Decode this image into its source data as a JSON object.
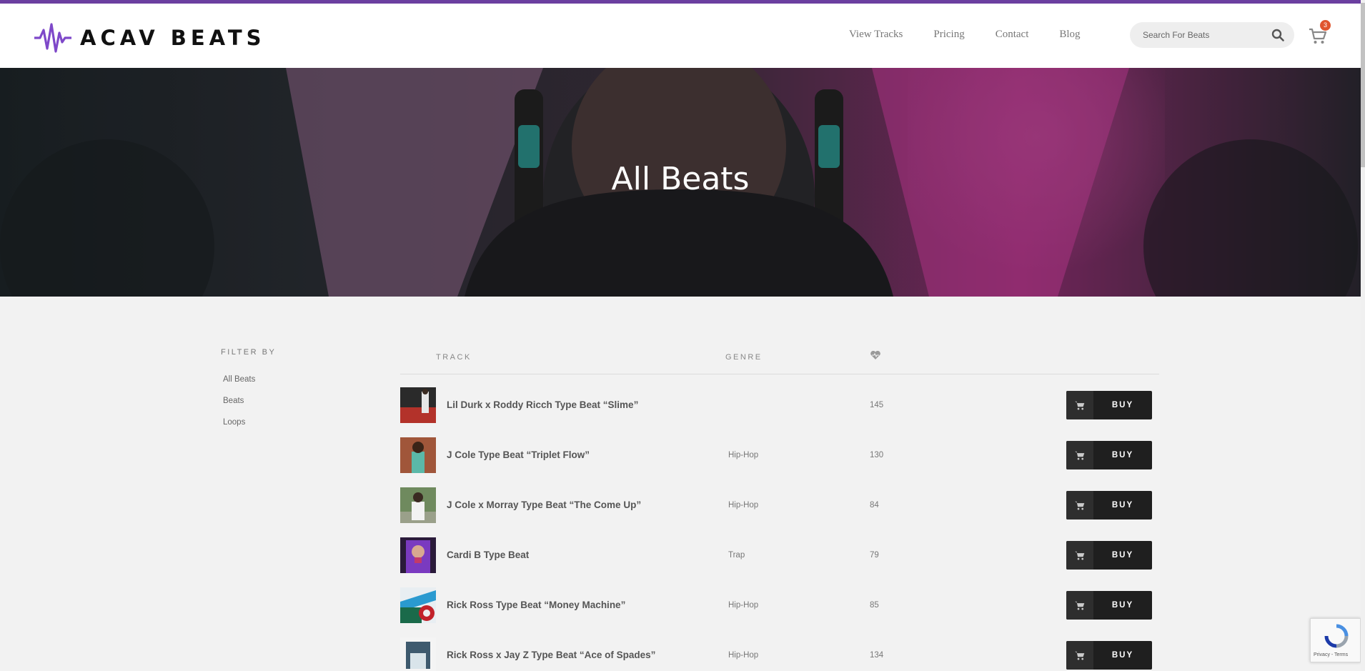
{
  "brand": {
    "name": "ACAV BEATS",
    "accent": "#7e48c9"
  },
  "nav": [
    {
      "label": "View Tracks"
    },
    {
      "label": "Pricing"
    },
    {
      "label": "Contact"
    },
    {
      "label": "Blog"
    }
  ],
  "search": {
    "placeholder": "Search For Beats",
    "icon": "search-icon"
  },
  "cart": {
    "count": "3",
    "icon": "cart-icon"
  },
  "hero": {
    "title": "All Beats"
  },
  "filter": {
    "title": "FILTER BY",
    "items": [
      {
        "label": "All Beats"
      },
      {
        "label": "Beats"
      },
      {
        "label": "Loops"
      }
    ]
  },
  "table": {
    "headers": {
      "track": "TRACK",
      "genre": "GENRE",
      "likes_icon": "heart-pulse-icon"
    },
    "buy_label": "BUY",
    "rows": [
      {
        "title": "Lil Durk x Roddy Ricch Type Beat “Slime”",
        "genre": "",
        "plays": "145"
      },
      {
        "title": "J Cole Type Beat “Triplet Flow”",
        "genre": "Hip-Hop",
        "plays": "130"
      },
      {
        "title": "J Cole x Morray Type Beat “The Come Up”",
        "genre": "Hip-Hop",
        "plays": "84"
      },
      {
        "title": "Cardi B Type Beat",
        "genre": "Trap",
        "plays": "79"
      },
      {
        "title": "Rick Ross Type Beat “Money Machine”",
        "genre": "Hip-Hop",
        "plays": "85"
      },
      {
        "title": "Rick Ross x Jay Z Type Beat “Ace of Spades”",
        "genre": "Hip-Hop",
        "plays": "134"
      }
    ]
  },
  "recaptcha": {
    "text": "Privacy - Terms"
  }
}
